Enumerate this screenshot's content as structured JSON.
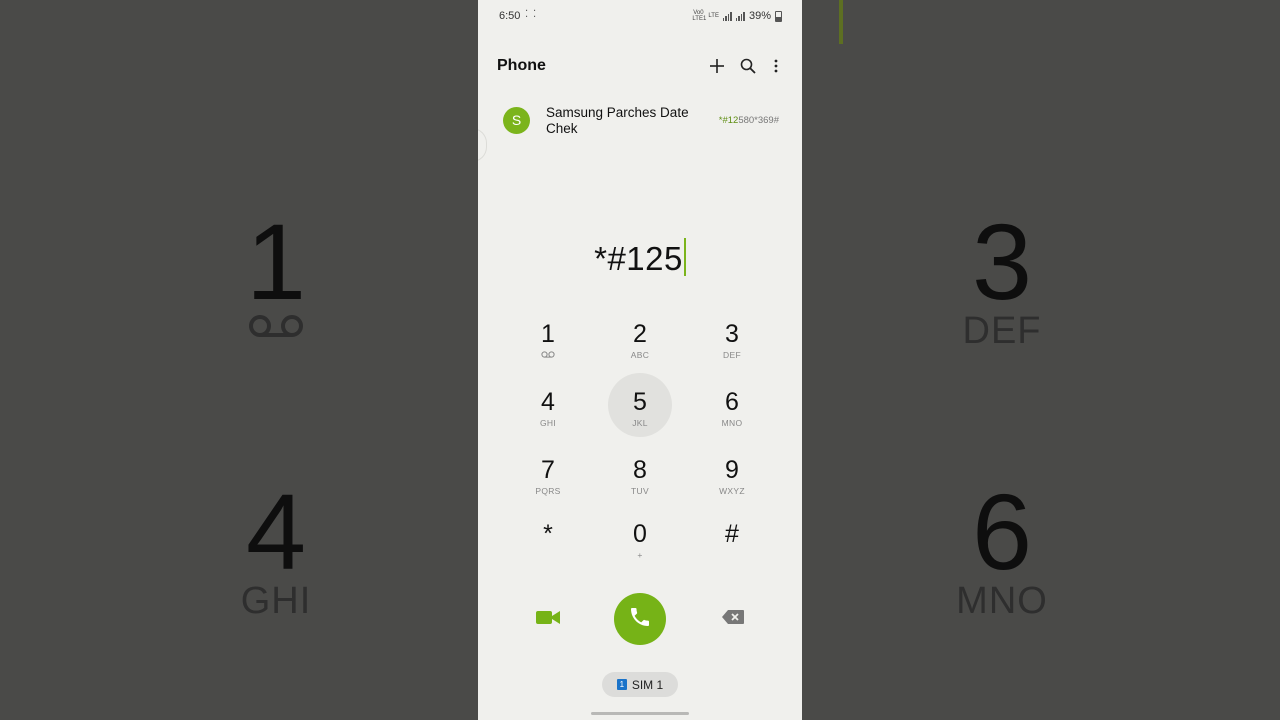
{
  "background": {
    "left_digit_1": "1",
    "left_digit_4": "4",
    "left_letters_4": "GHI",
    "right_digit_3": "3",
    "right_letters_3": "DEF",
    "right_digit_6": "6",
    "right_letters_6": "MNO"
  },
  "status_bar": {
    "time": "6:50",
    "notification_icons": "⁚ ⁚",
    "volte_label": "Vo0 LTE1",
    "lte_label": "LTE",
    "battery": "39%"
  },
  "app_bar": {
    "title": "Phone",
    "icons": [
      "add-icon",
      "search-icon",
      "more-options-icon"
    ]
  },
  "suggestion": {
    "avatar_letter": "S",
    "name": "Samsung Parches Date Chek",
    "number_prefix": "*#125",
    "number_match_display": "*#12",
    "number_rest": "580*369#"
  },
  "dial_input": {
    "value": "*#125"
  },
  "keypad": {
    "keys": [
      {
        "digit": "1",
        "letters": "⌵"
      },
      {
        "digit": "2",
        "letters": "ABC"
      },
      {
        "digit": "3",
        "letters": "DEF"
      },
      {
        "digit": "4",
        "letters": "GHI"
      },
      {
        "digit": "5",
        "letters": "JKL"
      },
      {
        "digit": "6",
        "letters": "MNO"
      },
      {
        "digit": "7",
        "letters": "PQRS"
      },
      {
        "digit": "8",
        "letters": "TUV"
      },
      {
        "digit": "9",
        "letters": "WXYZ"
      },
      {
        "digit": "*",
        "letters": ""
      },
      {
        "digit": "0",
        "letters": "+"
      },
      {
        "digit": "#",
        "letters": ""
      }
    ],
    "pressed_key": "5"
  },
  "actions": {
    "video_icon": "video-call-icon",
    "call_icon": "phone-icon",
    "backspace_icon": "backspace-icon"
  },
  "sim": {
    "badge": "1",
    "label": "SIM 1"
  },
  "colors": {
    "accent_green": "#76b317",
    "sim_blue": "#1a73c9",
    "panel_bg": "#f0f0ed"
  }
}
